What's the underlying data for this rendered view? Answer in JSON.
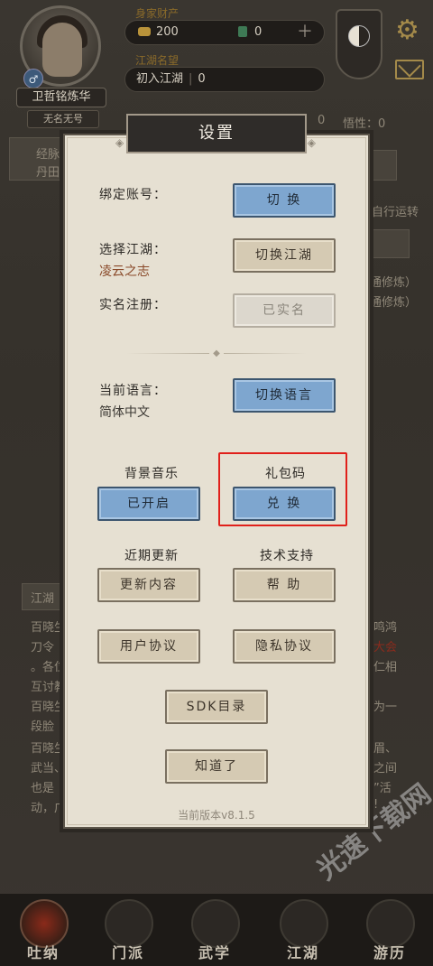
{
  "background": {
    "player_name": "卫哲铭炼华",
    "player_title": "无名无号",
    "assets_label": "身家财产",
    "coins": "200",
    "jade": "0",
    "reputation_label": "江湖名望",
    "reputation_rank": "初入江湖",
    "reputation_value": "0",
    "side_text_1": "经脉",
    "side_text_2": "丹田",
    "stat_fragment": "0",
    "stat_label": "悟性：0",
    "auto_text": "自行运转",
    "train_text_1": "通修炼）",
    "train_text_2": "通修炼）",
    "notice_tab": "江湖",
    "notice_lines": [
      "百晓生",
      "刀令",
      "。各位",
      "互讨教",
      "百晓生",
      "段脸",
      "百晓生",
      "武当、",
      "也是",
      "动，广"
    ],
    "notice_right": [
      "鸣鸿",
      "大会",
      "仁相",
      "为一",
      "眉、",
      "之间",
      "”活",
      "!"
    ]
  },
  "nav": {
    "tabs": [
      {
        "label": "吐纳"
      },
      {
        "label": "门派"
      },
      {
        "label": "武学"
      },
      {
        "label": "江湖"
      },
      {
        "label": "游历"
      }
    ]
  },
  "watermark": "光速下载网",
  "dialog": {
    "title": "设置",
    "bind_label": "绑定账号：",
    "bind_button": "切 换",
    "world_label": "选择江湖：",
    "world_value": "凌云之志",
    "world_button": "切换江湖",
    "realname_label": "实名注册：",
    "realname_button": "已实名",
    "language_label": "当前语言：",
    "language_value": "简体中文",
    "language_button": "切换语言",
    "music_label": "背景音乐",
    "music_button": "已开启",
    "gift_label": "礼包码",
    "gift_button": "兑 换",
    "updates_label": "近期更新",
    "updates_button": "更新内容",
    "support_label": "技术支持",
    "support_button": "帮 助",
    "user_agreement_button": "用户协议",
    "privacy_button": "隐私协议",
    "sdk_button": "SDK目录",
    "ok_button": "知道了",
    "version": "当前版本v8.1.5"
  },
  "colors": {
    "highlight": "#e0201a",
    "button_blue": "#7ea6cf",
    "button_beige": "#d5cab3",
    "dialog_bg": "#e6e0d2"
  }
}
